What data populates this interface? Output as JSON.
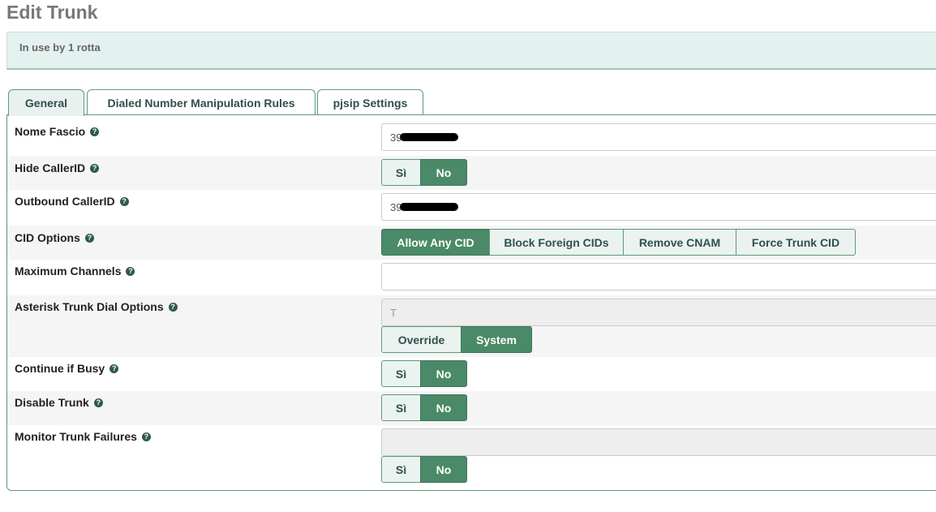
{
  "page": {
    "title": "Edit Trunk",
    "notice": "In use by 1 rotta"
  },
  "tabs": [
    {
      "label": "General",
      "active": true
    },
    {
      "label": "Dialed Number Manipulation Rules",
      "active": false
    },
    {
      "label": "pjsip Settings",
      "active": false
    }
  ],
  "form": {
    "help_glyph": "?",
    "trunk_name": {
      "label": "Nome Fascio",
      "value": "39"
    },
    "hide_callerid": {
      "label": "Hide CallerID",
      "options": [
        "Sì",
        "No"
      ],
      "selected": "No"
    },
    "outbound_callerid": {
      "label": "Outbound CallerID",
      "value": "39"
    },
    "cid_options": {
      "label": "CID Options",
      "options": [
        "Allow Any CID",
        "Block Foreign CIDs",
        "Remove CNAM",
        "Force Trunk CID"
      ],
      "selected": "Allow Any CID"
    },
    "max_channels": {
      "label": "Maximum Channels",
      "value": ""
    },
    "dial_options": {
      "label": "Asterisk Trunk Dial Options",
      "value": "T",
      "options": [
        "Override",
        "System"
      ],
      "selected": "System"
    },
    "continue_busy": {
      "label": "Continue if Busy",
      "options": [
        "Sì",
        "No"
      ],
      "selected": "No"
    },
    "disable_trunk": {
      "label": "Disable Trunk",
      "options": [
        "Sì",
        "No"
      ],
      "selected": "No"
    },
    "monitor_failures": {
      "label": "Monitor Trunk Failures",
      "value": "",
      "options": [
        "Sì",
        "No"
      ],
      "selected": "No"
    }
  },
  "colors": {
    "accent": "#4a8a68",
    "tab_border": "#5c9a78",
    "notice_bg": "#e3f1ef"
  }
}
